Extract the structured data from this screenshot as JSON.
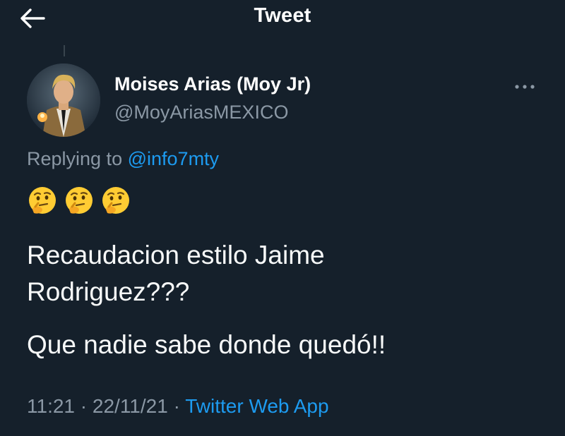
{
  "header": {
    "title": "Tweet",
    "back_icon": "arrow-left-icon"
  },
  "author": {
    "display_name": "Moises Arias (Moy Jr)",
    "handle": "@MoyAriasMEXICO"
  },
  "reply": {
    "prefix": "Replying to",
    "mention": "@info7mty"
  },
  "tweet": {
    "emojis": [
      "thinking-face-icon",
      "thinking-face-icon",
      "thinking-face-icon"
    ],
    "line1": "Recaudacion estilo Jaime",
    "line2": "Rodriguez???",
    "line3": "Que nadie sabe donde quedó!!"
  },
  "meta": {
    "time": "11:21",
    "date": "22/11/21",
    "sep": "·",
    "source": "Twitter Web App"
  },
  "colors": {
    "background": "#15202b",
    "accent": "#1d9bf0",
    "secondary_text": "#8b98a5"
  }
}
